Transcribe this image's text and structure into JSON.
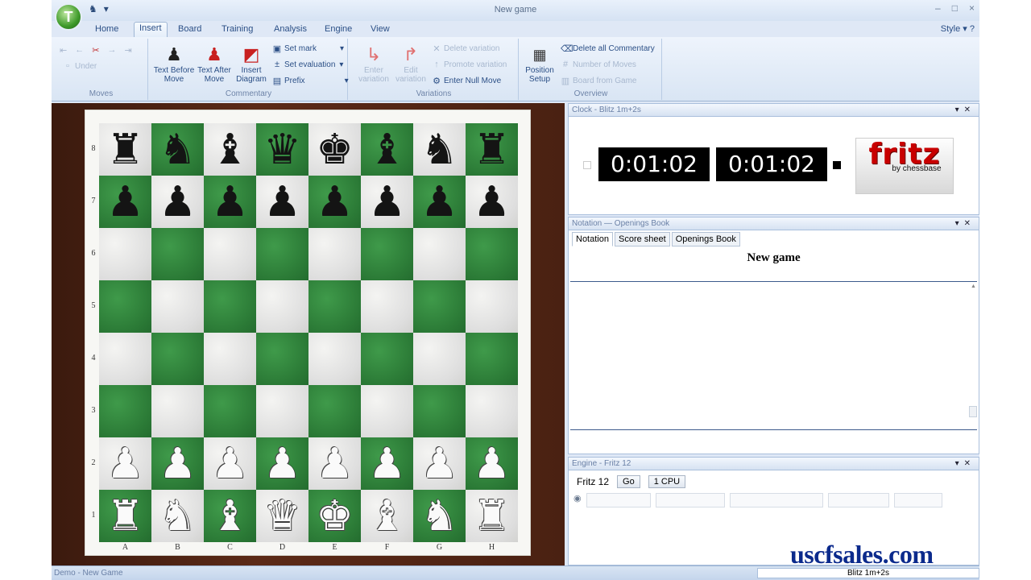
{
  "titlebar": {
    "logo_letter": "T",
    "qat_icons": [
      "chess-figure-icon",
      "dropdown-arrow-icon"
    ],
    "qat_dropdown": "▾",
    "title": "New game",
    "controls": [
      "–",
      "□",
      "×"
    ]
  },
  "tabs": [
    {
      "label": "Home"
    },
    {
      "label": "Insert"
    },
    {
      "label": "Board"
    },
    {
      "label": "Training"
    },
    {
      "label": "Analysis"
    },
    {
      "label": "Engine"
    },
    {
      "label": "View"
    }
  ],
  "style_menu": "Style",
  "ribbon": {
    "moves": {
      "label": "Moves",
      "under": "Under"
    },
    "commentary": {
      "label": "Commentary",
      "text_before": "Text Before Move",
      "text_after": "Text After Move",
      "insert_diagram": "Insert Diagram",
      "set_mark": "Set mark",
      "set_evaluation": "Set evaluation",
      "prefix": "Prefix"
    },
    "variations": {
      "label": "Variations",
      "enter_variation": "Enter variation",
      "edit_variation": "Edit variation",
      "delete_variation": "Delete variation",
      "promote_variation": "Promote variation",
      "enter_null_move": "Enter Null Move"
    },
    "overview": {
      "label": "Overview",
      "position_setup": "Position Setup",
      "delete_all_commentary": "Delete all Commentary",
      "number_of_moves": "Number of Moves",
      "board_from_game": "Board from Game"
    }
  },
  "board": {
    "ranks": [
      "8",
      "7",
      "6",
      "5",
      "4",
      "3",
      "2",
      "1"
    ],
    "files": [
      "A",
      "B",
      "C",
      "D",
      "E",
      "F",
      "G",
      "H"
    ],
    "rows": [
      [
        "r",
        "n",
        "b",
        "q",
        "k",
        "b",
        "n",
        "r"
      ],
      [
        "p",
        "p",
        "p",
        "p",
        "p",
        "p",
        "p",
        "p"
      ],
      [
        "",
        "",
        "",
        "",
        "",
        "",
        "",
        ""
      ],
      [
        "",
        "",
        "",
        "",
        "",
        "",
        "",
        ""
      ],
      [
        "",
        "",
        "",
        "",
        "",
        "",
        "",
        ""
      ],
      [
        "",
        "",
        "",
        "",
        "",
        "",
        "",
        ""
      ],
      [
        "P",
        "P",
        "P",
        "P",
        "P",
        "P",
        "P",
        "P"
      ],
      [
        "R",
        "N",
        "B",
        "Q",
        "K",
        "B",
        "N",
        "R"
      ]
    ]
  },
  "clock": {
    "header": "Clock - Blitz 1m+2s",
    "white_time": "0:01:02",
    "black_time": "0:01:02",
    "logo_text": "fritz",
    "logo_sub": "by chessbase"
  },
  "notation": {
    "header": "Notation — Openings Book",
    "tabs": [
      "Notation",
      "Score sheet",
      "Openings Book"
    ],
    "game_title": "New game"
  },
  "engine": {
    "header": "Engine - Fritz 12",
    "name": "Fritz 12",
    "go": "Go",
    "cpu": "1 CPU"
  },
  "watermark": "uscfsales.com",
  "status": {
    "left": "Demo - New Game",
    "right": "Blitz 1m+2s"
  }
}
